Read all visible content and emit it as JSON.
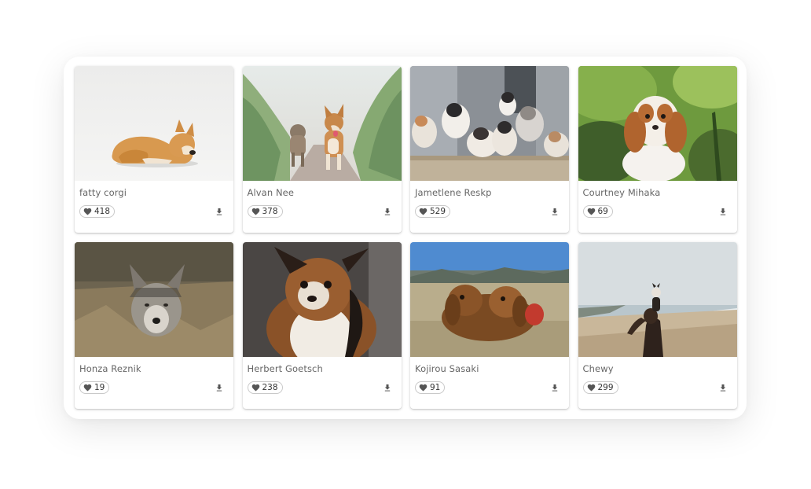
{
  "cards": [
    {
      "author": "fatty corgi",
      "likes": "418",
      "image": "corgi lying on white background"
    },
    {
      "author": "Alvan Nee",
      "likes": "378",
      "image": "two small dogs walking on path between grass"
    },
    {
      "author": "Jametlene Reskp",
      "likes": "529",
      "image": "litter of australian shepherd puppies"
    },
    {
      "author": "Courtney Mihaka",
      "likes": "69",
      "image": "cavalier king charles spaniel in garden"
    },
    {
      "author": "Honza Reznik",
      "likes": "19",
      "image": "wolfdog lying in dry grass"
    },
    {
      "author": "Herbert Goetsch",
      "likes": "238",
      "image": "long-haired chihuahua portrait"
    },
    {
      "author": "Kojirou Sasaki",
      "likes": "91",
      "image": "two dachshunds on the beach"
    },
    {
      "author": "Chewy",
      "likes": "299",
      "image": "woman holding dog on beach"
    }
  ],
  "icons": {
    "like": "heart-icon",
    "download": "download-icon"
  },
  "colors": {
    "heart": "#555555",
    "text": "#666666",
    "border": "#c9c9c9"
  }
}
